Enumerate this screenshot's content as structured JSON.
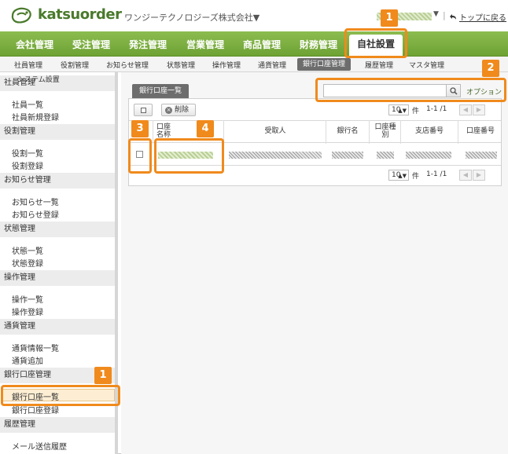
{
  "header": {
    "logo_text": "katsuorder",
    "company": "ワンジーテクノロジーズ株式会社▼",
    "user_caret": "▼",
    "separator": "|",
    "top_link": "トップに戻る"
  },
  "main_nav": {
    "items": [
      "会社管理",
      "受注管理",
      "発注管理",
      "営業管理",
      "商品管理",
      "財務管理"
    ],
    "active": "自社設置"
  },
  "sub_nav": {
    "items": [
      "社員管理",
      "役割管理",
      "お知らせ管理",
      "状態管理",
      "操作管理",
      "通貨管理"
    ],
    "active": "銀行口座管理",
    "after": [
      "履歴管理",
      "マスタ管理"
    ]
  },
  "sidebar": {
    "top_overlap_a": "社員管理",
    "top_overlap_b": "システム設置",
    "groups": [
      {
        "head": "社員管理",
        "items": [
          "社員一覧",
          "社員新規登録"
        ]
      },
      {
        "head": "役割管理",
        "items": [
          "役割一覧",
          "役割登録"
        ]
      },
      {
        "head": "お知らせ管理",
        "items": [
          "お知らせ一覧",
          "お知らせ登録"
        ]
      },
      {
        "head": "状態管理",
        "items": [
          "状態一覧",
          "状態登録"
        ]
      },
      {
        "head": "操作管理",
        "items": [
          "操作一覧",
          "操作登録"
        ]
      },
      {
        "head": "通貨管理",
        "items": [
          "通貨情報一覧",
          "通貨追加"
        ]
      },
      {
        "head": "銀行口座管理",
        "items": [
          "銀行口座一覧",
          "銀行口座登録"
        ]
      },
      {
        "head": "履歴管理",
        "items": [
          "メール送信履歴"
        ]
      }
    ],
    "selected": "銀行口座一覧"
  },
  "content": {
    "tab_label": "銀行口座一覧",
    "search": {
      "value": "",
      "placeholder": ""
    },
    "option_link": "オプション",
    "delete_label": "削除",
    "pager": {
      "per_page": "10",
      "unit": "件",
      "range": "1-1 /1",
      "prev": "◀",
      "next": "▶",
      "caret": "▲▼"
    },
    "table": {
      "headers": [
        "口座\n名称",
        "受取人",
        "銀行名",
        "口座種\n別",
        "支店番号",
        "口座番号"
      ]
    }
  },
  "callouts": [
    "1",
    "2",
    "3",
    "4",
    "1"
  ],
  "colors": {
    "nav_green": "#7cb040",
    "callout_orange": "#f08a1c",
    "selected_bg": "#fdeed3"
  }
}
